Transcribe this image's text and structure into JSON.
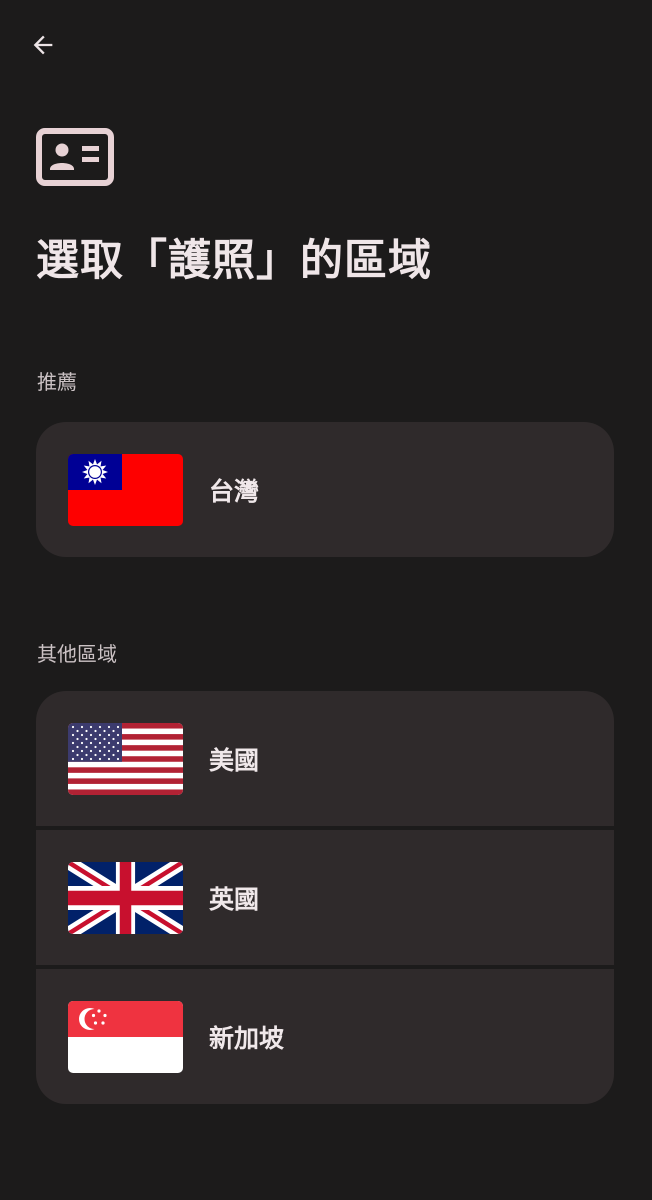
{
  "page": {
    "title": "選取「護照」的區域"
  },
  "sections": {
    "recommended_label": "推薦",
    "others_label": "其他區域"
  },
  "regions": {
    "recommended": [
      {
        "name": "台灣",
        "flag_icon": "taiwan-flag-icon"
      }
    ],
    "others": [
      {
        "name": "美國",
        "flag_icon": "usa-flag-icon"
      },
      {
        "name": "英國",
        "flag_icon": "uk-flag-icon"
      },
      {
        "name": "新加坡",
        "flag_icon": "singapore-flag-icon"
      }
    ]
  },
  "icons": {
    "back": "back-arrow-icon",
    "document": "id-card-icon"
  },
  "colors": {
    "background": "#1c1b1b",
    "card": "#2f2a2b",
    "accent_icon": "#e7d2d5",
    "text": "#efe6e8",
    "label": "#cbc2c4"
  }
}
